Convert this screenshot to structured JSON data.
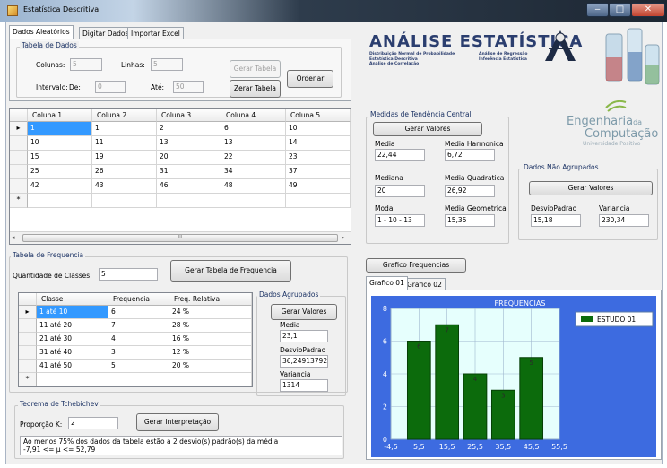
{
  "window": {
    "title": "Estatística Descritiva",
    "minimize": "‒",
    "maximize": "□",
    "close": "✕"
  },
  "top_tabs": [
    "Dados Aleatórios",
    "Digitar Dados",
    "Importar Excel"
  ],
  "tabela_dados": {
    "title": "Tabela de Dados",
    "colunas_label": "Colunas:",
    "colunas_value": "5",
    "linhas_label": "Linhas:",
    "linhas_value": "5",
    "gerar_tabela": "Gerar Tabela",
    "ordenar": "Ordenar",
    "intervalo_label": "Intervalo:",
    "de_label": "De:",
    "de_value": "0",
    "ate_label": "Até:",
    "ate_value": "50",
    "zerar_tabela": "Zerar Tabela"
  },
  "data_grid": {
    "columns": [
      "Coluna 1",
      "Coluna 2",
      "Coluna 3",
      "Coluna 4",
      "Coluna 5"
    ],
    "rows": [
      [
        "1",
        "1",
        "2",
        "6",
        "10"
      ],
      [
        "10",
        "11",
        "13",
        "13",
        "14"
      ],
      [
        "15",
        "19",
        "20",
        "22",
        "23"
      ],
      [
        "25",
        "26",
        "31",
        "34",
        "37"
      ],
      [
        "42",
        "43",
        "46",
        "48",
        "49"
      ]
    ],
    "new_row_marker": "*",
    "current_row_marker": "▸",
    "scroll_left": "◂",
    "scroll_right": "▸",
    "scroll_grip": "III"
  },
  "frequencia": {
    "title": "Tabela de Frequencia",
    "classes_label": "Quantidade de Classes",
    "classes_value": "5",
    "gerar_button": "Gerar Tabela de Frequencia",
    "columns": [
      "Classe",
      "Frequencia",
      "Freq. Relativa"
    ],
    "rows": [
      [
        "1 até 10",
        "6",
        "24 %"
      ],
      [
        "11 até 20",
        "7",
        "28 %"
      ],
      [
        "21 até 30",
        "4",
        "16 %"
      ],
      [
        "31 até 40",
        "3",
        "12 %"
      ],
      [
        "41 até 50",
        "5",
        "20 %"
      ]
    ]
  },
  "agrupados": {
    "title": "Dados Agrupados",
    "gerar": "Gerar Valores",
    "media_label": "Media",
    "media_value": "23,1",
    "desvio_label": "DesvioPadrao",
    "desvio_value": "36,249137920",
    "variancia_label": "Variancia",
    "variancia_value": "1314"
  },
  "tchebichev": {
    "title": "Teorema de Tchebichev",
    "proporcao_label": "Proporção K:",
    "proporcao_value": "2",
    "gerar": "Gerar Interpretação",
    "result_line1": "Ao menos 75% dos dados da tabela estão a 2 desvio(s) padrão(s) da média",
    "result_line2": "-7,91 <= µ <= 52,79"
  },
  "banner": {
    "title": "ANÁLISE ESTATÍSTICA",
    "left_lines": [
      "Distribuição Normal de Probabilidade",
      "Estatística Descritiva",
      "Análise de Correlação"
    ],
    "right_lines": [
      "Análise de Regressão",
      "Inferência Estatística"
    ]
  },
  "logo": {
    "line1": "Engenharia",
    "line1_suffix": "da",
    "line2": "Computação",
    "line3": "Universidade Positivo"
  },
  "tendencia": {
    "title": "Medidas de Tendência Central",
    "gerar": "Gerar Valores",
    "media_label": "Media",
    "media_value": "22,44",
    "harmonica_label": "Media Harmonica",
    "harmonica_value": "6,72",
    "mediana_label": "Mediana",
    "mediana_value": "20",
    "quadratica_label": "Media Quadratica",
    "quadratica_value": "26,92",
    "moda_label": "Moda",
    "moda_value": "1 - 10 - 13",
    "geometrica_label": "Media Geometrica",
    "geometrica_value": "15,35"
  },
  "nao_agrupados": {
    "title": "Dados Não Agrupados",
    "gerar": "Gerar Valores",
    "desvio_label": "DesvioPadrao",
    "desvio_value": "15,18",
    "variancia_label": "Variancia",
    "variancia_value": "230,34"
  },
  "grafico": {
    "button": "Grafico Frequencias",
    "tabs": [
      "Grafico 01",
      "Grafico 02"
    ]
  },
  "colors": {
    "chart_outer": "#3d6be0",
    "plot_bg": "#e6fffd",
    "bar": "#0c6b0c",
    "title_text": "#ffffff",
    "selection": "#3399ff"
  },
  "chart_data": {
    "type": "bar",
    "title": "FREQUENCIAS",
    "x": [
      5.5,
      15.5,
      25.5,
      35.5,
      45.5
    ],
    "values": [
      6,
      7,
      4,
      3,
      5
    ],
    "data_labels": [
      "6",
      "7",
      "4",
      "3",
      "5"
    ],
    "series": [
      {
        "name": "ESTUDO 01",
        "values": [
          6,
          7,
          4,
          3,
          5
        ]
      }
    ],
    "xticks": [
      "-4,5",
      "5,5",
      "15,5",
      "25,5",
      "35,5",
      "45,5",
      "55,5"
    ],
    "xlim": [
      -4.5,
      55.5
    ],
    "yticks": [
      "0",
      "2",
      "4",
      "6",
      "8"
    ],
    "ylim": [
      0,
      8
    ],
    "legend": "top-right",
    "grid": true
  }
}
